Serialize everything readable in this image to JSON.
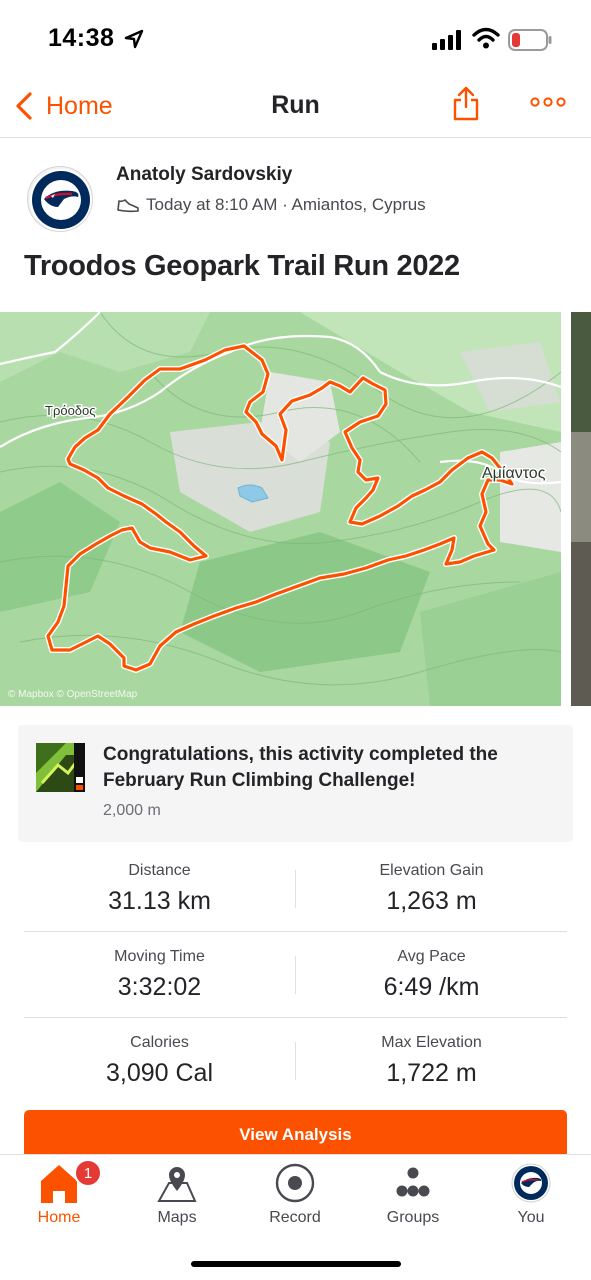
{
  "status_bar": {
    "time": "14:38",
    "battery_level": 0.12,
    "battery_color": "#e53935"
  },
  "nav": {
    "back_label": "Home",
    "title": "Run"
  },
  "athlete": {
    "name": "Anatoly Sardovskiy",
    "meta": "Today at 8:10 AM · Amiantos, Cyprus",
    "avatar": "new-england-patriots-logo"
  },
  "activity": {
    "title": "Troodos Geopark Trail Run 2022"
  },
  "map": {
    "labels": {
      "troodos": "Τρόοδος",
      "amiantos": "Αμίαντος"
    },
    "attribution": "© Mapbox © OpenStreetMap",
    "route_color": "#fc5200"
  },
  "challenge": {
    "text": "Congratulations, this activity completed the February Run Climbing Challenge!",
    "subtext": "2,000 m",
    "badge_icon": "february-climbing-badge"
  },
  "stats": [
    {
      "left": {
        "label": "Distance",
        "value": "31.13 km"
      },
      "right": {
        "label": "Elevation Gain",
        "value": "1,263 m"
      }
    },
    {
      "left": {
        "label": "Moving Time",
        "value": "3:32:02"
      },
      "right": {
        "label": "Avg Pace",
        "value": "6:49 /km"
      }
    },
    {
      "left": {
        "label": "Calories",
        "value": "3,090 Cal"
      },
      "right": {
        "label": "Max Elevation",
        "value": "1,722 m"
      }
    }
  ],
  "analysis_button": "View Analysis",
  "tabs": [
    {
      "label": "Home",
      "icon": "home-icon",
      "badge": "1",
      "active": true
    },
    {
      "label": "Maps",
      "icon": "map-pin-icon"
    },
    {
      "label": "Record",
      "icon": "record-icon"
    },
    {
      "label": "Groups",
      "icon": "groups-icon"
    },
    {
      "label": "You",
      "icon": "avatar-icon"
    }
  ],
  "colors": {
    "accent": "#fc5200",
    "text": "#242428"
  }
}
